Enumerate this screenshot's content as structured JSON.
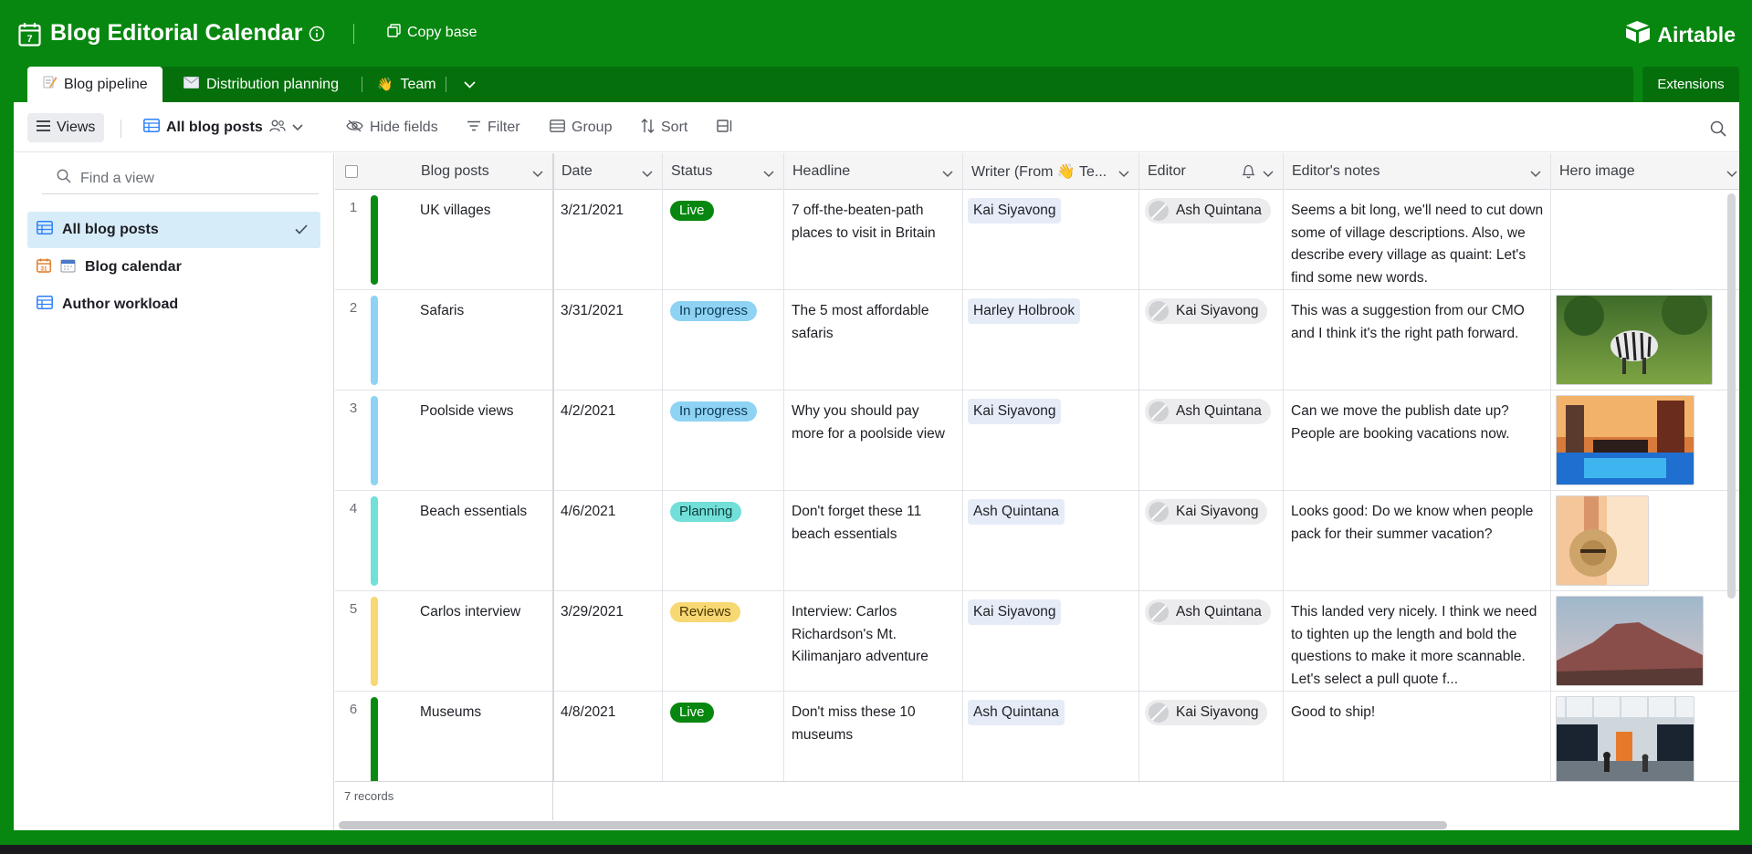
{
  "header": {
    "base_title": "Blog Editorial Calendar",
    "copy_base_label": "Copy base",
    "logo_text": "Airtable",
    "brand_color": "#07870f"
  },
  "tabs": [
    {
      "label": "Blog pipeline",
      "icon": "pencil-memo-icon",
      "active": true
    },
    {
      "label": "Distribution planning",
      "icon": "envelope-icon",
      "active": false
    },
    {
      "label": "Team",
      "icon": "waving-hand-icon",
      "active": false
    }
  ],
  "extensions_label": "Extensions",
  "toolbar": {
    "views_label": "Views",
    "view_name": "All blog posts",
    "hide_fields": "Hide fields",
    "filter": "Filter",
    "group": "Group",
    "sort": "Sort"
  },
  "sidebar": {
    "find_placeholder": "Find a view",
    "views": [
      {
        "label": "All blog posts",
        "type": "grid",
        "active": true
      },
      {
        "label": "Blog calendar",
        "type": "calendar",
        "active": false
      },
      {
        "label": "Author workload",
        "type": "grid",
        "active": false
      }
    ]
  },
  "grid": {
    "columns": [
      "Blog posts",
      "Date",
      "Status",
      "Headline",
      "Writer (From 👋 Te...",
      "Editor",
      "Editor's notes",
      "Hero image"
    ],
    "rows": [
      {
        "num": "1",
        "bar": "#0b8a13",
        "post": "UK villages",
        "date": "3/21/2021",
        "status": "Live",
        "status_bg": "#07870f",
        "status_fg": "#ffffff",
        "headline": "7 off-the-beaten-path places to visit in Britain",
        "writer": "Kai Siyavong",
        "editor": "Ash Quintana",
        "notes": "Seems a bit long, we'll need to cut down some of village descriptions. Also, we describe every village as quaint: Let's find some new words.",
        "hero": "none"
      },
      {
        "num": "2",
        "bar": "#8fd3f4",
        "post": "Safaris",
        "date": "3/31/2021",
        "status": "In progress",
        "status_bg": "#8fd3f4",
        "status_fg": "#0d3a56",
        "headline": "The 5 most affordable safaris",
        "writer": "Harley Holbrook",
        "editor": "Kai Siyavong",
        "notes": "This was a suggestion from our CMO and I think it's the right path forward.",
        "hero": "zebras"
      },
      {
        "num": "3",
        "bar": "#8fd3f4",
        "post": "Poolside views",
        "date": "4/2/2021",
        "status": "In progress",
        "status_bg": "#8fd3f4",
        "status_fg": "#0d3a56",
        "headline": "Why you should pay more for a poolside view",
        "writer": "Kai Siyavong",
        "editor": "Ash Quintana",
        "notes": "Can we move the publish date up? People are booking vacations now.",
        "hero": "pool"
      },
      {
        "num": "4",
        "bar": "#72dfd8",
        "post": "Beach essentials",
        "date": "4/6/2021",
        "status": "Planning",
        "status_bg": "#72dfd8",
        "status_fg": "#0b3d3a",
        "headline": "Don't forget these 11 beach essentials",
        "writer": "Ash Quintana",
        "editor": "Kai Siyavong",
        "notes": "Looks good: Do we know when people pack for their summer vacation?",
        "hero": "hat"
      },
      {
        "num": "5",
        "bar": "#f7d873",
        "post": "Carlos interview",
        "date": "3/29/2021",
        "status": "Reviews",
        "status_bg": "#f7d873",
        "status_fg": "#4a3700",
        "headline": "Interview: Carlos Richardson's Mt. Kilimanjaro adventure",
        "writer": "Kai Siyavong",
        "editor": "Ash Quintana",
        "notes": "This landed very nicely. I think we need to tighten up the length and bold the questions to make it more scannable. Let's select a pull quote f...",
        "hero": "mountain"
      },
      {
        "num": "6",
        "bar": "#0b8a13",
        "post": "Museums",
        "date": "4/8/2021",
        "status": "Live",
        "status_bg": "#07870f",
        "status_fg": "#ffffff",
        "headline": "Don't miss these 10 museums",
        "writer": "Ash Quintana",
        "editor": "Kai Siyavong",
        "notes": "Good to ship!",
        "hero": "museum"
      }
    ],
    "record_count": "7 records"
  }
}
